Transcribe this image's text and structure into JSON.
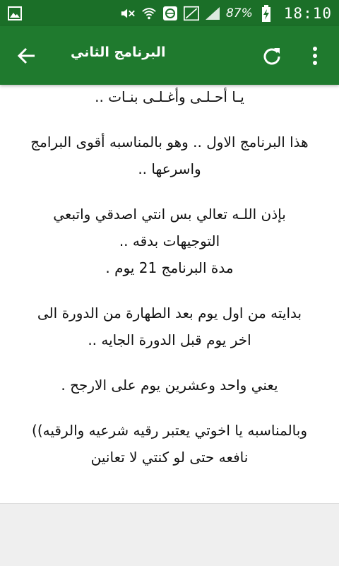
{
  "status_bar": {
    "battery_percent": "87%",
    "time": "18:10",
    "icons": [
      "image-icon",
      "mute-icon",
      "wifi-icon",
      "browser-icon",
      "no-signal-icon",
      "signal-icon",
      "battery-charging-icon"
    ]
  },
  "toolbar": {
    "title": "البرنامج الثاني",
    "back_icon": "arrow-back-icon",
    "refresh_icon": "refresh-icon",
    "more_icon": "more-vert-icon"
  },
  "content": {
    "paragraphs": [
      [
        "يـا أحـلـى وأغـلـى بنـات .."
      ],
      [
        "هذا البرنامج الاول .. وهو بالمناسبه أقوى البرامج",
        "واسرعها .."
      ],
      [
        "بإذن اللـه تعالي بس انتي اصدقي واتبعي",
        "التوجيهات بدقه ..",
        "مدة البرنامج 21 يوم ."
      ],
      [
        "بدايته من اول يوم بعد الطهارة من الدورة الى",
        "اخر يوم قبل الدورة الجايه .."
      ],
      [
        "يعني واحد وعشرين يوم على الارجح ."
      ],
      [
        "وبالمناسبه يا اخوتي يعتبر رقيه شرعيه والرقيه))",
        "نافعه حتى لو كنتي لا تعانين"
      ]
    ]
  },
  "colors": {
    "status_bar": "#1b6f28",
    "toolbar": "#1f7a2e",
    "bottom_area": "#efefef"
  }
}
